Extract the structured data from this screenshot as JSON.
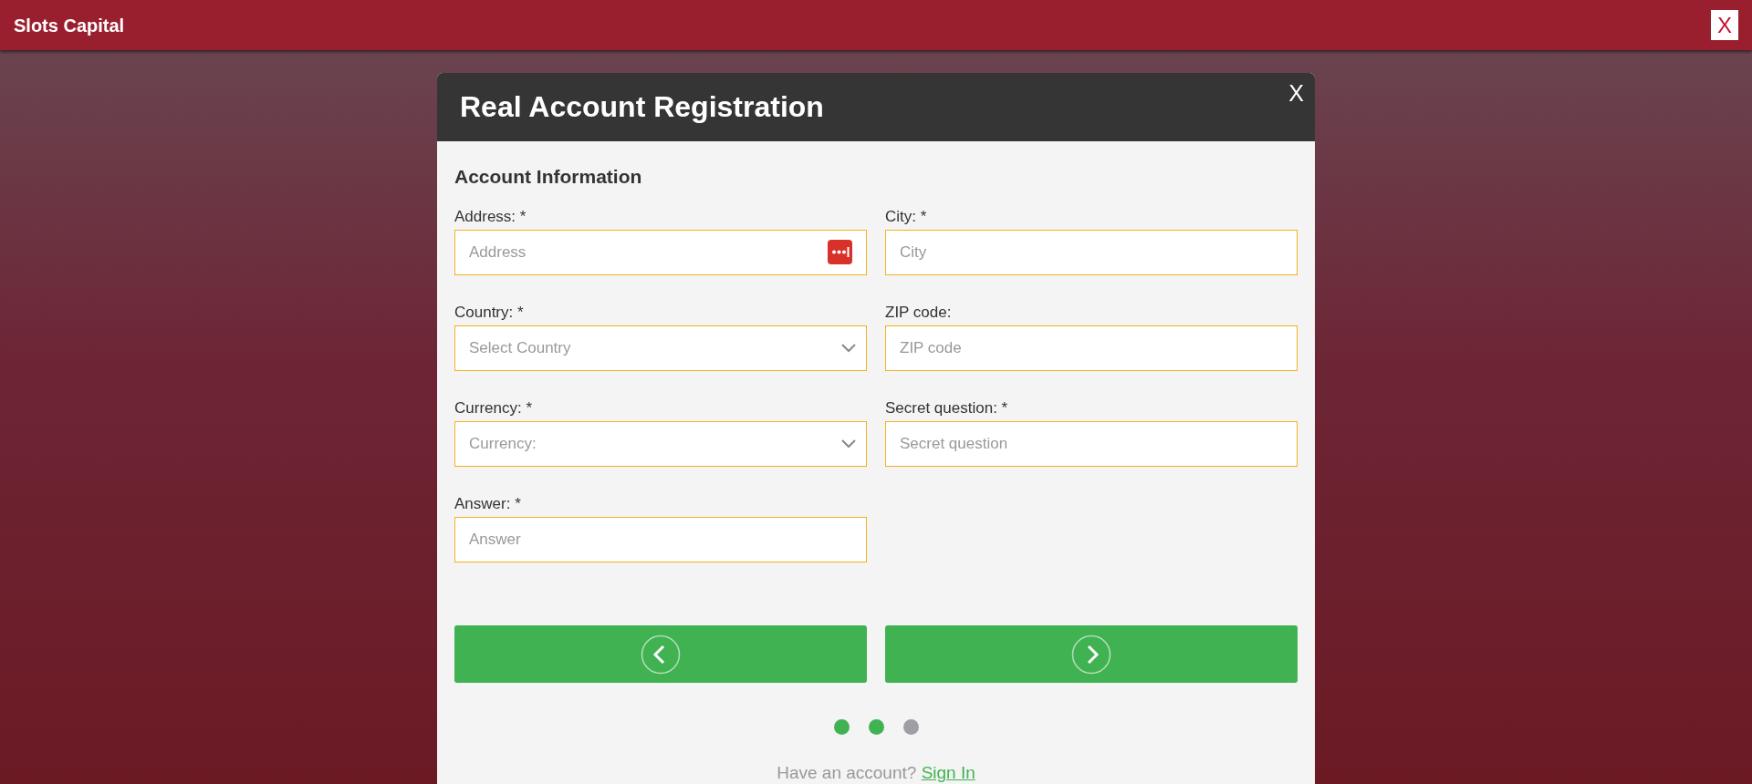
{
  "app_bar": {
    "title": "Slots Capital",
    "close": "X"
  },
  "dialog": {
    "title": "Real Account Registration",
    "close": "X",
    "section_title": "Account Information",
    "fields": [
      {
        "label": "Address: *",
        "kind": "text",
        "placeholder": "Address",
        "autofill_icon": true
      },
      {
        "label": "City: *",
        "kind": "text",
        "placeholder": "City",
        "autofill_icon": false
      },
      {
        "label": "Country: *",
        "kind": "select",
        "placeholder": "Select Country",
        "autofill_icon": false
      },
      {
        "label": "ZIP code:",
        "kind": "text",
        "placeholder": "ZIP code",
        "autofill_icon": false
      },
      {
        "label": "Currency: *",
        "kind": "select",
        "placeholder": "Currency:",
        "autofill_icon": false
      },
      {
        "label": "Secret question: *",
        "kind": "text",
        "placeholder": "Secret question",
        "autofill_icon": false
      },
      {
        "label": "Answer: *",
        "kind": "text",
        "placeholder": "Answer",
        "autofill_icon": false
      }
    ],
    "nav_buttons": [
      {
        "kind": "back"
      },
      {
        "kind": "next"
      }
    ],
    "steps": [
      {
        "filled": true
      },
      {
        "filled": true
      },
      {
        "filled": false
      }
    ],
    "footer": {
      "text": "Have an account?",
      "link": "Sign In"
    }
  }
}
